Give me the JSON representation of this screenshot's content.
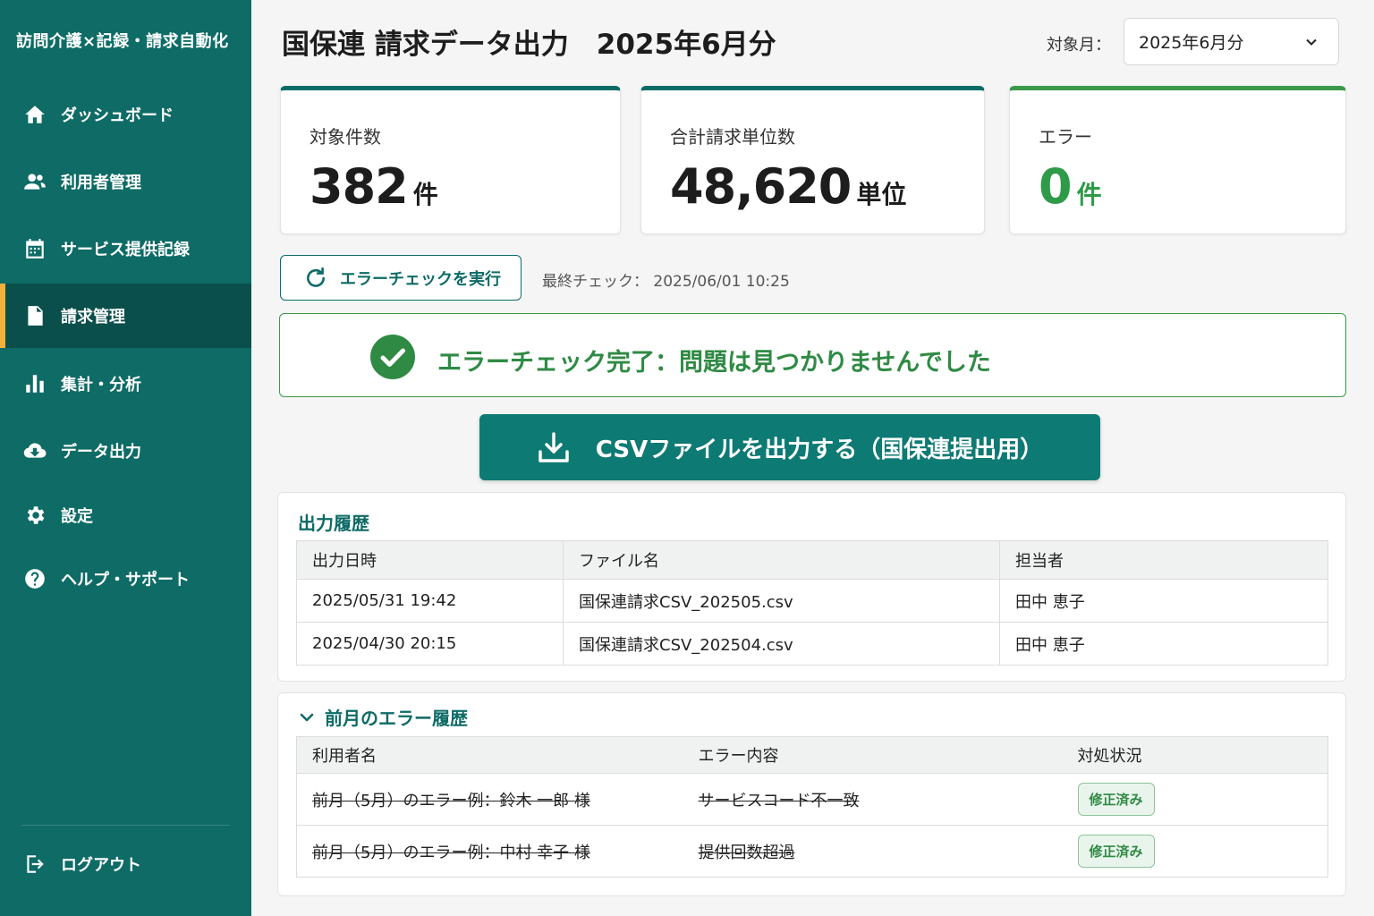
{
  "app": {
    "title": "訪問介護×記録・請求自動化"
  },
  "sidebar": {
    "items": [
      {
        "label": "ダッシュボード",
        "icon": "home-icon"
      },
      {
        "label": "利用者管理",
        "icon": "users-icon"
      },
      {
        "label": "サービス提供記録",
        "icon": "calendar-icon"
      },
      {
        "label": "請求管理",
        "icon": "document-icon",
        "active": true
      },
      {
        "label": "集計・分析",
        "icon": "bar-chart-icon"
      },
      {
        "label": "データ出力",
        "icon": "cloud-download-icon"
      },
      {
        "label": "設定",
        "icon": "gear-icon"
      },
      {
        "label": "ヘルプ・サポート",
        "icon": "help-icon"
      }
    ],
    "logout_label": "ログアウト"
  },
  "header": {
    "title": "国保連 請求データ出力　2025年6月分",
    "month_label": "対象月：",
    "month_value": "2025年6月分"
  },
  "stats": {
    "target": {
      "label": "対象件数",
      "value": "382",
      "unit": "件"
    },
    "units": {
      "label": "合計請求単位数",
      "value": "48,620",
      "unit": "単位"
    },
    "errors": {
      "label": "エラー",
      "value": "0",
      "unit": "件"
    }
  },
  "check": {
    "button_label": "エラーチェックを実行",
    "last_check": "最終チェック：  2025/06/01 10:25",
    "result_text": "エラーチェック完了：問題は見つかりませんでした"
  },
  "csv_button_label": "CSVファイルを出力する（国保連提出用）",
  "history": {
    "title": "出力履歴",
    "columns": [
      "出力日時",
      "ファイル名",
      "担当者"
    ],
    "rows": [
      [
        "2025/05/31 19:42",
        "国保連請求CSV_202505.csv",
        "田中 恵子"
      ],
      [
        "2025/04/30 20:15",
        "国保連請求CSV_202504.csv",
        "田中 恵子"
      ]
    ]
  },
  "errors_prev": {
    "title": "前月のエラー履歴",
    "columns": [
      "利用者名",
      "エラー内容",
      "対処状況"
    ],
    "rows": [
      [
        "前月（5月）のエラー例：鈴木 一郎 様",
        "サービスコード不一致",
        "修正済み"
      ],
      [
        "前月（5月）のエラー例：中村 幸子 様",
        "提供回数超過",
        "修正済み"
      ]
    ]
  },
  "colors": {
    "sidebar": "#0e6b66",
    "accent": "#0e7a74",
    "success": "#2f8a44",
    "active_marker": "#f4b13a"
  }
}
